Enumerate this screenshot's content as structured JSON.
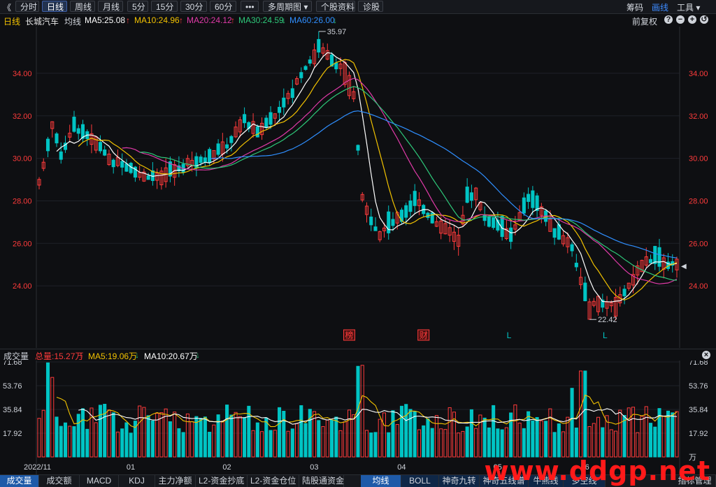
{
  "toolbar": {
    "back_glyph": "《",
    "tabs": [
      "分时",
      "日线",
      "周线",
      "月线",
      "5分",
      "15分",
      "30分",
      "60分"
    ],
    "active_tab": "日线",
    "more": "•••",
    "multi": "多周期图",
    "profile": "个股资料",
    "diag": "诊股",
    "right": [
      "筹码",
      "画线",
      "工具"
    ],
    "right_active": "画线"
  },
  "info": {
    "period": "日线",
    "name": "长城汽车",
    "type": "均线",
    "ma5": "MA5:25.08",
    "ma10": "MA10:24.96",
    "ma20": "MA20:24.12",
    "ma30": "MA30:24.59",
    "ma60": "MA60:26.00",
    "fq": "前复权",
    "icons": [
      "?",
      "−",
      "+",
      "↺"
    ]
  },
  "colors": {
    "up": "#ff3b3b",
    "down": "#00c4c4",
    "ma5": "#ffffff",
    "ma10": "#f2c200",
    "ma20": "#e03aa8",
    "ma30": "#2ec97a",
    "ma60": "#2f8fff",
    "grid": "#1e2128"
  },
  "chart_data": [
    {
      "type": "candlestick",
      "title": "长城汽车 日线",
      "y_ticks": [
        "34.00",
        "32.00",
        "30.00",
        "28.00",
        "26.00",
        "24.00"
      ],
      "ylim": [
        22.0,
        36.2
      ],
      "x_ticks": [
        "2022/11",
        "01",
        "02",
        "03",
        "04",
        "05",
        "06"
      ],
      "annotations": {
        "high": "35.97",
        "low": "22.42"
      },
      "markers": [
        {
          "text": "榜",
          "x_index": 71,
          "color": "#ff3b3b",
          "boxed": true
        },
        {
          "text": "财",
          "x_index": 88,
          "color": "#ff3b3b",
          "boxed": true
        },
        {
          "text": "L",
          "x_index": 108,
          "color": "#00c4c4",
          "boxed": false
        },
        {
          "text": "L",
          "x_index": 130,
          "color": "#00c4c4",
          "boxed": false
        }
      ],
      "close_anchors": [
        [
          0,
          28.8
        ],
        [
          3,
          31.5
        ],
        [
          5,
          30.2
        ],
        [
          8,
          31.5
        ],
        [
          12,
          31.0
        ],
        [
          16,
          30.0
        ],
        [
          20,
          29.6
        ],
        [
          24,
          29.1
        ],
        [
          28,
          29.2
        ],
        [
          33,
          29.6
        ],
        [
          38,
          30.0
        ],
        [
          43,
          30.6
        ],
        [
          47,
          31.8
        ],
        [
          50,
          31.3
        ],
        [
          54,
          32.0
        ],
        [
          58,
          33.1
        ],
        [
          61,
          34.3
        ],
        [
          64,
          35.2
        ],
        [
          67,
          34.6
        ],
        [
          70,
          34.2
        ],
        [
          72,
          33.0
        ],
        [
          73,
          30.5
        ],
        [
          74,
          28.2
        ],
        [
          76,
          27.0
        ],
        [
          78,
          26.4
        ],
        [
          80,
          26.8
        ],
        [
          83,
          27.3
        ],
        [
          86,
          28.0
        ],
        [
          88,
          27.6
        ],
        [
          91,
          26.9
        ],
        [
          94,
          26.5
        ],
        [
          96,
          26.2
        ],
        [
          98,
          28.2
        ],
        [
          100,
          28.4
        ],
        [
          102,
          27.2
        ],
        [
          105,
          26.8
        ],
        [
          108,
          26.3
        ],
        [
          112,
          28.1
        ],
        [
          115,
          27.6
        ],
        [
          118,
          26.6
        ],
        [
          122,
          25.8
        ],
        [
          124,
          24.2
        ],
        [
          126,
          23.0
        ],
        [
          128,
          23.3
        ],
        [
          130,
          23.0
        ],
        [
          132,
          23.2
        ],
        [
          135,
          24.0
        ],
        [
          138,
          25.0
        ],
        [
          141,
          25.3
        ],
        [
          144,
          25.1
        ],
        [
          146,
          25.08
        ]
      ],
      "volume": {
        "y_ticks": [
          "71.68",
          "53.76",
          "35.84",
          "17.92"
        ],
        "unit": "万",
        "max": 71.68
      }
    }
  ],
  "vol_info": {
    "label": "成交量",
    "total": "总量:15.27万",
    "ma5": "MA5:19.06万",
    "ma10": "MA10:20.67万"
  },
  "bottom_tabs": [
    "成交量",
    "成交额",
    "MACD",
    "KDJ",
    "主力净额",
    "L2-资金抄底",
    "L2-资金仓位",
    "陆股通资金",
    "均线",
    "BOLL",
    "神奇九转",
    "神奇五线谱",
    "牛熊线",
    "多空线",
    "指标管理"
  ],
  "watermark": "www.ddgp.net"
}
